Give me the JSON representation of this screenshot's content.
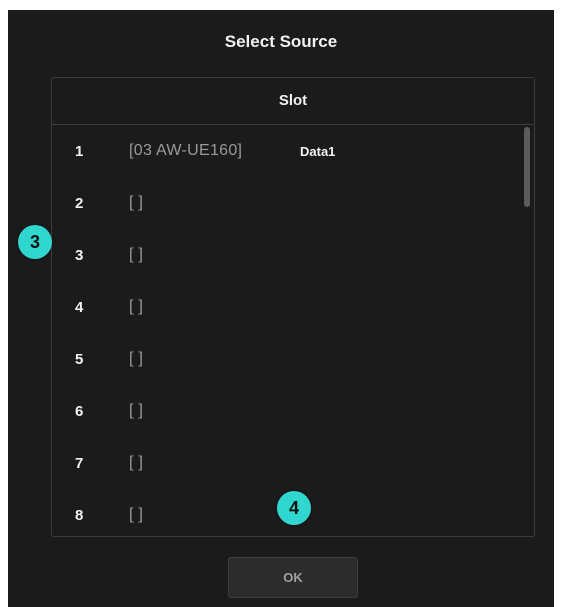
{
  "dialog": {
    "title": "Select Source",
    "ok_label": "OK"
  },
  "slot_table": {
    "header": "Slot",
    "rows": [
      {
        "number": "1",
        "source": "[03 AW-UE160]",
        "tag": "Data1"
      },
      {
        "number": "2",
        "source": "[ ]",
        "tag": ""
      },
      {
        "number": "3",
        "source": "[ ]",
        "tag": ""
      },
      {
        "number": "4",
        "source": "[ ]",
        "tag": ""
      },
      {
        "number": "5",
        "source": "[ ]",
        "tag": ""
      },
      {
        "number": "6",
        "source": "[ ]",
        "tag": ""
      },
      {
        "number": "7",
        "source": "[ ]",
        "tag": ""
      },
      {
        "number": "8",
        "source": "[ ]",
        "tag": ""
      }
    ]
  },
  "callouts": [
    "3",
    "4"
  ],
  "colors": {
    "dialog_bg": "#1b1b1b",
    "border": "#3d3d3d",
    "text": "#f2f2f2",
    "muted_text": "#9a9a9a",
    "callout": "#2fd7cf"
  }
}
